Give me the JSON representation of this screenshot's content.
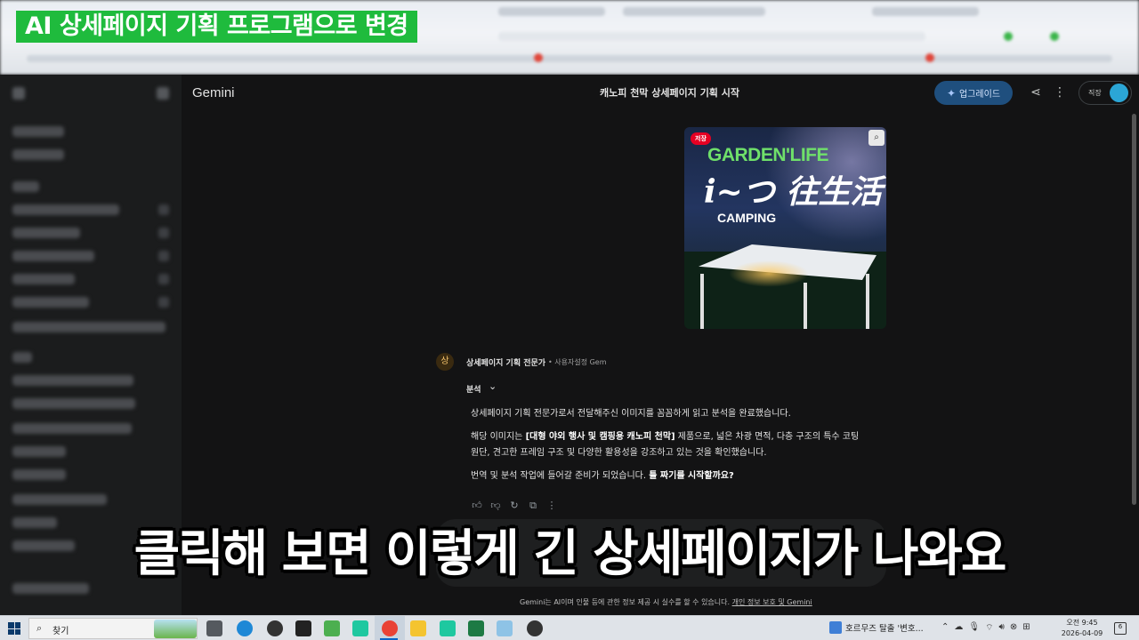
{
  "banner": {
    "title": "AI 상세페이지 기획 프로그램으로 변경"
  },
  "gemini": {
    "logo": "Gemini",
    "chat_title": "캐노피 천막 상세페이지 기획 시작",
    "upgrade_label": "업그레이드",
    "account_label": "직장"
  },
  "image": {
    "pin_badge": "저장",
    "brand_text": "GARDEN'LIFE",
    "calligraphy_text": "i~つ 往生活",
    "camping_text": "CAMPING"
  },
  "chat": {
    "avatar_char": "상",
    "gem_name": "상세페이지 기획 전문가",
    "gem_sub": "• 사용자설정 Gem",
    "analysis_label": "분석",
    "paragraph_1": "상세페이지 기획 전문가로서 전달해주신 이미지를 꼼꼼하게 읽고 분석을 완료했습니다.",
    "paragraph_2_prefix": "해당 이미지는 ",
    "paragraph_2_bold": "[대형 야외 행사 및 캠핑용 캐노피 천막]",
    "paragraph_2_mid": " 제품으로, 넓은 차광 면적, 다층 구조의 특수 코팅",
    "paragraph_2_line2": "원단, 견고한 프레임 구조 및 다양한 활용성을 강조하고 있는 것을 확인했습니다.",
    "paragraph_3_prefix": "번역 및 분석 작업에 들어갈 준비가 되었습니다. ",
    "paragraph_3_bold": "틀 짜기를 시작할까요?"
  },
  "disclaimer": {
    "text": "Gemini는 AI이며 인물 등에 관한 정보 제공 시 실수를 할 수 있습니다. ",
    "link": "개인 정보 보호 및 Gemini"
  },
  "caption": {
    "text": "클릭해 보면 이렇게 긴 상세페이지가 나와요"
  },
  "taskbar": {
    "search_placeholder": "찾기",
    "window_title": "호르무즈 탈출 '변호...",
    "clock_time": "오전 9:45",
    "clock_date": "2026-04-09",
    "notification_count": "6"
  },
  "colors": {
    "banner_green": "#1fbb3d",
    "upgrade_blue": "#1f4f7e",
    "background": "#131314"
  }
}
